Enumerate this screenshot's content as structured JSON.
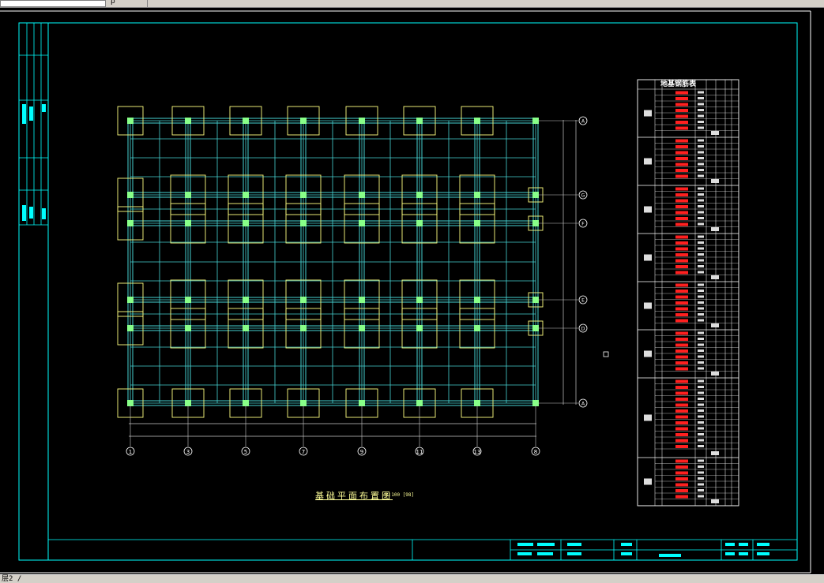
{
  "window": {
    "command_input_value": "",
    "toolbar_glyph": "ρ",
    "status_text": "层2 /"
  },
  "drawing": {
    "plan_title": "基础平面布置图",
    "plan_scale": "1:100 [98]",
    "table_title": "地基钢筋表",
    "grid_axes_horizontal": [
      "1",
      "3",
      "5",
      "7",
      "9",
      "11",
      "13",
      "8"
    ],
    "grid_axes_vertical": [
      "A",
      "G",
      "F",
      "E",
      "D",
      "A"
    ],
    "colors": {
      "background": "#000000",
      "border": "#00ffff",
      "grid": "#46d2d2",
      "footing": "#ffff80",
      "column": "#88ff88",
      "table": "#ffffff",
      "highlight": "#ff2020"
    }
  }
}
